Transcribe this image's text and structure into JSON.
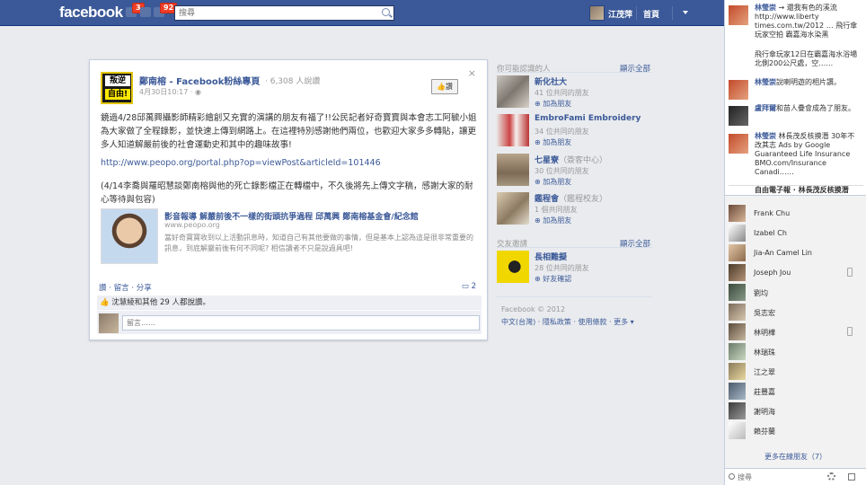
{
  "topbar": {
    "logo": "facebook",
    "friend_requests_count": "3",
    "notifications_count": "92",
    "search_placeholder": "搜尋",
    "user_name": "江茂萍",
    "home_label": "首頁"
  },
  "story": {
    "logo_line1": "叛逆",
    "logo_line2": "自由!",
    "poster": "鄭南榕 - Facebook粉絲專頁",
    "likes_count": "· 6,308 人說讚",
    "time": "4月30日10:17 · ",
    "like_button": "👍讚",
    "body": "鏡過4/28邱萬興攝影師精彩繪創又充實的演講的朋友有福了!!公民記者好奇寶寶與本會志工阿毓小姐為大家做了全程錄影，並快速上傳到網路上。在這裡特別感謝他們兩位，也歡迎大家多多轉貼，讓更多人知道解嚴前後的社會運動史和其中的趣味故事!",
    "url": "http://www.peopo.org/portal.php?op=viewPost&articleId=101446",
    "body2": "(4/14李喬與羅昭慧談鄭南榕與他的死亡錄影檔正在轉檔中，不久後將先上傳文字稿，感謝大家的耐心等待與包容)",
    "share_title": "影音報導 解嚴前後不一樣的街頭抗爭過程 邱萬興 鄭南榕基金會/紀念館",
    "share_site": "www.peopo.org",
    "share_desc": "當好奇寶寶收到以上活動訊息時，知道自己有其他要做的事情，但是基本上認為這是很非常重要的訊息，到底解嚴前後有何不同呢? 相信讀者不只是說過具吧!",
    "actions": "讚 · 留言 · 分享",
    "comment_count": "2",
    "ufi_likes": "沈慧綾和其他 29 人都說讚。",
    "comment_placeholder": "留言……"
  },
  "right_column": {
    "pymk_header": "你可能認識的人",
    "see_all": "顯示全部",
    "suggestions": [
      {
        "name": "新化社大",
        "sub": "41 位共同的朋友",
        "add": "加為朋友"
      },
      {
        "name": "EmbroFami Embroidery",
        "sub": "34 位共同的朋友",
        "add": "加為朋友"
      },
      {
        "name": "七星寮",
        "sub": "（簽客中心）",
        "sub2": "30 位共同的朋友",
        "add": "加為朋友"
      },
      {
        "name": "鑑程會",
        "sub": "（鑑程校友）",
        "sub2": "1 個共同朋友",
        "add": "加為朋友"
      }
    ],
    "invites_header": "交友邀請",
    "invites_see_all": "顯示全部",
    "invite": {
      "name": "長相難擬",
      "sub": "28 位共同的朋友",
      "action": "好友確認"
    },
    "footer1": "Facebook © 2012",
    "footer2": "中文(台灣) · 隱私政策 · 使用條款 · 更多 ▾"
  },
  "ticker": [
    {
      "name": "林瑩崇",
      "text": "→ 還我有色的溪流 http://www.liberty times.com.tw/2012 … 飛行傘玩家空拍 霸嘉海水染黑"
    },
    {
      "name": "",
      "text": "飛行傘玩家12日在霸嘉海水浴場北側200公尺處，空……"
    },
    {
      "name": "林瑩崇",
      "text": "說喇明遊的相片讚。"
    },
    {
      "name": "盧拜爾",
      "text": "和苗人疊會成為了朋友。"
    },
    {
      "name": "林瑩崇",
      "text": "林長茂反核摸潛 30年不改其志 Ads by Google Guaranteed Life Insurance BMO.com/Insurance Canadi……"
    },
    {
      "name": "",
      "text": "自由電子報 · 林長茂反核摸潛"
    }
  ],
  "chat": {
    "friends": [
      "Frank Chu",
      "Izabel Ch",
      "Jia-An Camel Lin",
      "Joseph Jou",
      "劉均",
      "吳志宏",
      "林明樺",
      "林瑞珠",
      "江之翠",
      "莊豐嘉",
      "謝明海",
      "賴芬蘭"
    ],
    "more_online": "更多在線朋友（7）",
    "search_placeholder": "搜尋"
  }
}
